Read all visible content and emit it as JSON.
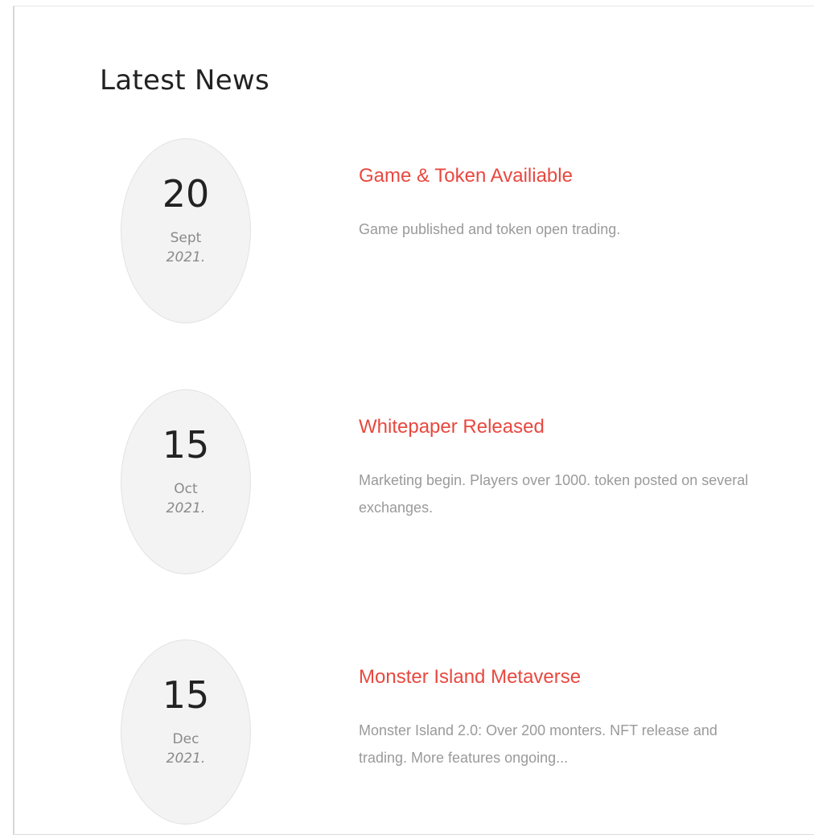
{
  "section": {
    "title": "Latest News"
  },
  "news": [
    {
      "day": "20",
      "month": "Sept",
      "year": "2021.",
      "title": "Game & Token Availiable",
      "description": "Game published and token open trading."
    },
    {
      "day": "15",
      "month": "Oct",
      "year": "2021.",
      "title": "Whitepaper Released",
      "description": "Marketing begin. Players over 1000. token posted on several exchanges."
    },
    {
      "day": "15",
      "month": "Dec",
      "year": "2021.",
      "title": "Monster Island Metaverse",
      "description": "Monster Island 2.0: Over 200 monters. NFT release and trading. More features ongoing..."
    }
  ],
  "colors": {
    "accent": "#e8483f",
    "heading": "#222222",
    "muted": "#9a9a9a",
    "oval_bg": "#f3f3f3"
  }
}
